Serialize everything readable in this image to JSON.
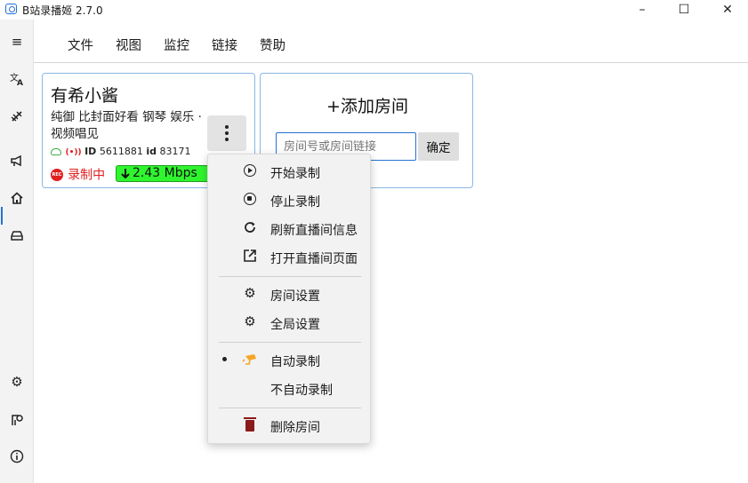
{
  "window": {
    "title": "B站录播姬 2.7.0",
    "controls": {
      "minimize": "–",
      "maximize": "☐",
      "close": "✕"
    }
  },
  "nav": {
    "icons": [
      "menu-icon",
      "translate-icon",
      "offline-tool-icon",
      "announce-icon",
      "home-icon",
      "car-icon",
      "settings-icon",
      "feedback-icon",
      "info-icon"
    ],
    "active": "home-icon"
  },
  "menu": [
    "文件",
    "视图",
    "监控",
    "链接",
    "赞助"
  ],
  "room": {
    "name": "有希小酱",
    "tags": "纯御 比封面好看 钢琴 娱乐 · 视频唱见",
    "live_marker": "(•))",
    "id_label": "ID",
    "room_id": "5611881",
    "short_id_label": "id",
    "short_id": "83171",
    "rec_badge": "REC",
    "status": "录制中",
    "speed": "2.43 Mbps"
  },
  "add_room": {
    "title": "+添加房间",
    "placeholder": "房间号或房间链接",
    "confirm": "确定"
  },
  "context_menu": {
    "items": [
      {
        "label": "开始录制",
        "icon": "play-circle-icon"
      },
      {
        "label": "停止录制",
        "icon": "stop-circle-icon"
      },
      {
        "label": "刷新直播间信息",
        "icon": "refresh-icon"
      },
      {
        "label": "打开直播间页面",
        "icon": "open-external-icon"
      },
      {
        "label": "房间设置",
        "icon": "gear-icon"
      },
      {
        "label": "全局设置",
        "icon": "gear-icon"
      },
      {
        "label": "自动录制",
        "icon": "auto-record-icon",
        "selected": true
      },
      {
        "label": "不自动录制",
        "icon": ""
      },
      {
        "label": "删除房间",
        "icon": "trash-icon"
      }
    ]
  },
  "colors": {
    "accent": "#2672d1",
    "card_border": "#8ab7e6",
    "recording": "#e02020",
    "speed_bg": "#2ff52f",
    "auto_record": "#f5a623",
    "delete": "#8b1a1a"
  }
}
